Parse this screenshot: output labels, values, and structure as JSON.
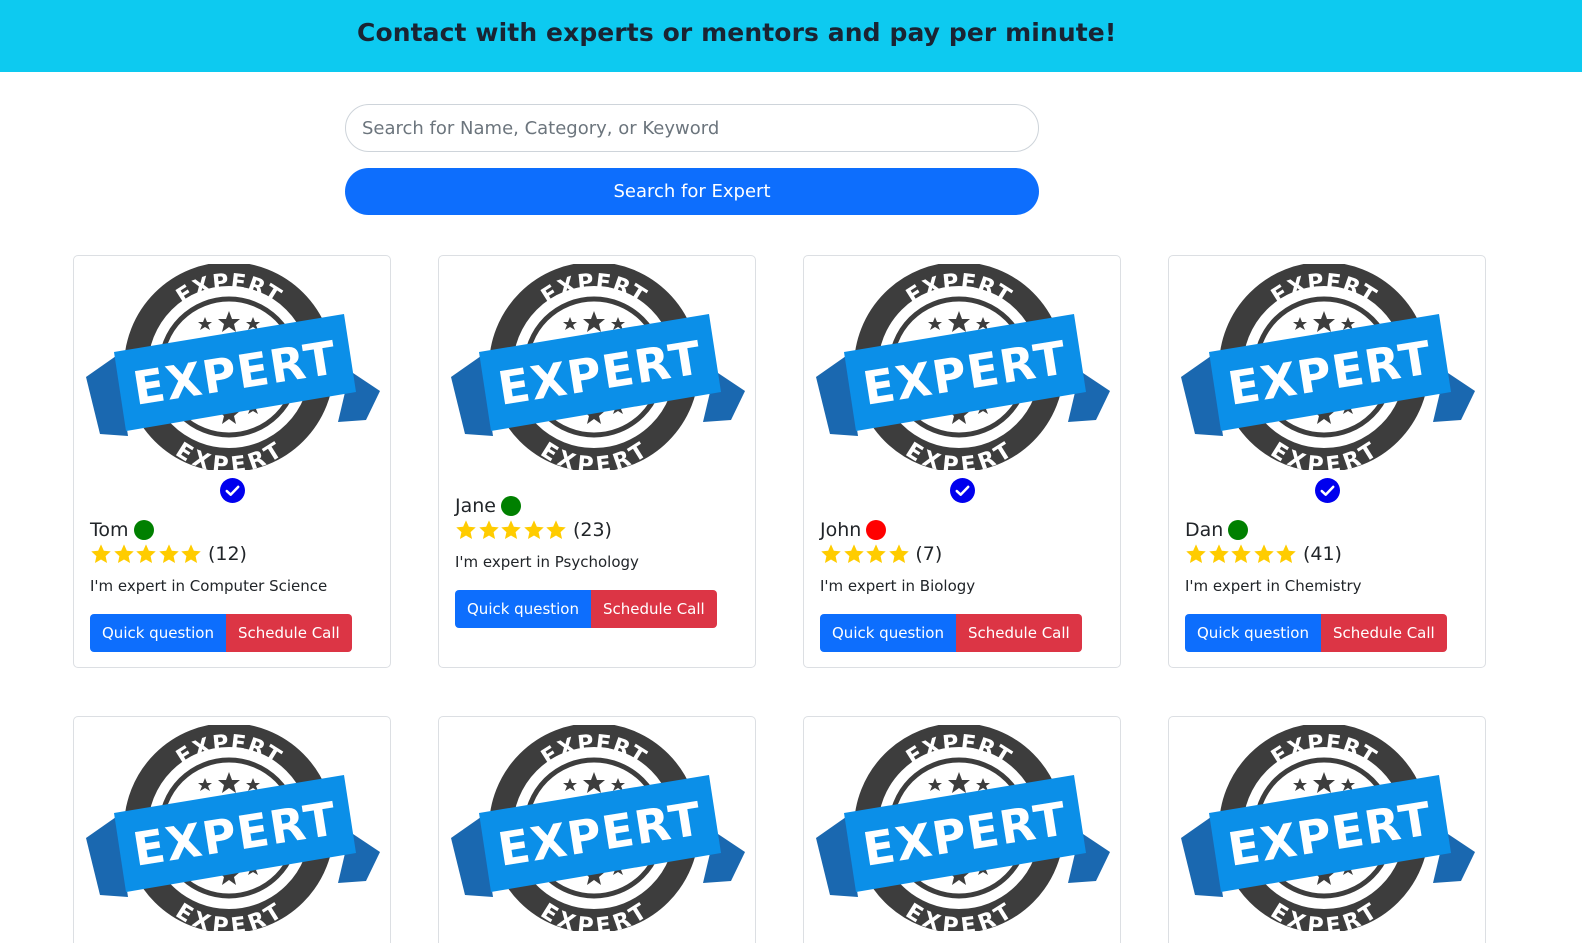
{
  "header": {
    "title": "Contact with experts or mentors and pay per minute!"
  },
  "search": {
    "placeholder": "Search for Name, Category, or Keyword",
    "button_label": "Search for Expert"
  },
  "badge": {
    "banner_text": "EXPERT",
    "ring_text": "EXPERT",
    "colors": {
      "ring": "#3d3d3d",
      "banner": "#0b8fe8",
      "banner_fold": "#1a68b0"
    }
  },
  "status_colors": {
    "online": "#008000",
    "offline": "#ff0000",
    "verified": "#0000ee",
    "star": "#ffcc00"
  },
  "experts": [
    {
      "name": "Tom",
      "status": "online",
      "verified": true,
      "rating_stars": 5,
      "review_count": "(12)",
      "description": "I'm expert in Computer Science",
      "quick_label": "Quick question",
      "schedule_label": "Schedule Call"
    },
    {
      "name": "Jane",
      "status": "online",
      "verified": false,
      "rating_stars": 5,
      "review_count": "(23)",
      "description": "I'm expert in Psychology",
      "quick_label": "Quick question",
      "schedule_label": "Schedule Call"
    },
    {
      "name": "John",
      "status": "offline",
      "verified": true,
      "rating_stars": 4,
      "review_count": "(7)",
      "description": "I'm expert in Biology",
      "quick_label": "Quick question",
      "schedule_label": "Schedule Call"
    },
    {
      "name": "Dan",
      "status": "online",
      "verified": true,
      "rating_stars": 5,
      "review_count": "(41)",
      "description": "I'm expert in Chemistry",
      "quick_label": "Quick question",
      "schedule_label": "Schedule Call"
    }
  ]
}
